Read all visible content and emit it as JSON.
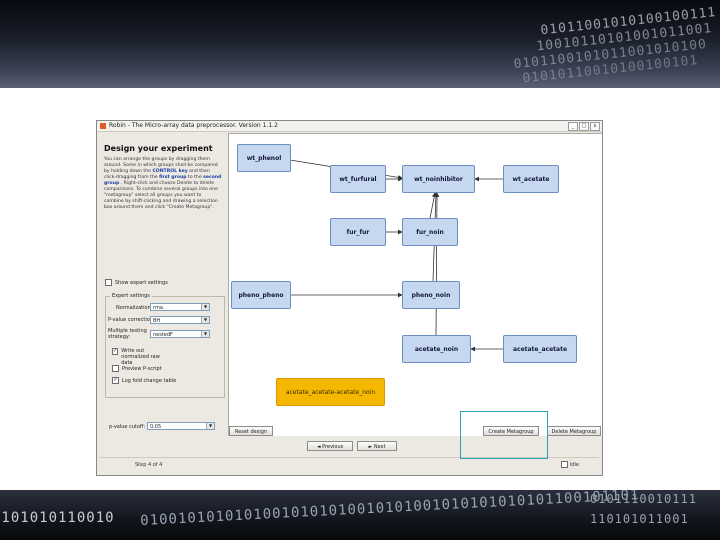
{
  "window": {
    "title": "Robin - The Micro-array data preprocessor. Version 1.1.2",
    "buttons": [
      "_",
      "□",
      "x"
    ]
  },
  "left_panel": {
    "heading": "Design your experiment",
    "description": {
      "t1": "You can arrange the groups by dragging them around. Some in which groups shall be compared by holding down the",
      "control_key": "CONTROL key",
      "t2": "and then click-dragging from the",
      "first_group": "first group",
      "t3": "to the",
      "second_group": "second group",
      "t4": ". Right-click and choose Delete to delete comparisons. To combine several groups into one \"metagroup\" select all groups you want to combine by shift-clicking and drawing a selection box around them and click \"Create Metagroup\"."
    },
    "show_expert": {
      "label": "Show expert settings",
      "checked": false
    },
    "expert_settings": {
      "title": "Expert settings",
      "normalization": {
        "label": "Normalization:",
        "value": "rma"
      },
      "pvalue_correction": {
        "label": "P-value correction:",
        "value": "BH"
      },
      "multiple_testing": {
        "label": "Multiple testing strategy:",
        "value": "nestedF"
      },
      "write_normalized": {
        "label": "Write out normalized raw data",
        "checked": true
      },
      "preview_plot": {
        "label": "Preview P-script",
        "checked": false
      },
      "log_fold_change": {
        "label": "Log fold change table",
        "checked": true
      }
    },
    "pvalue_cutoff": {
      "label": "p-value cutoff:",
      "value": "0.05"
    }
  },
  "diagram": {
    "nodes": [
      {
        "id": "wt_phenol",
        "label": "wt_phenol",
        "type": "group"
      },
      {
        "id": "wt_furfural",
        "label": "wt_furfural",
        "type": "group"
      },
      {
        "id": "wt_noinhibitor",
        "label": "wt_noinhibitor",
        "type": "group"
      },
      {
        "id": "wt_acetate",
        "label": "wt_acetate",
        "type": "group"
      },
      {
        "id": "fur_fur",
        "label": "fur_fur",
        "type": "group"
      },
      {
        "id": "fur_noin",
        "label": "fur_noin",
        "type": "group"
      },
      {
        "id": "pheno_pheno",
        "label": "pheno_pheno",
        "type": "group"
      },
      {
        "id": "pheno_noin",
        "label": "pheno_noin",
        "type": "group"
      },
      {
        "id": "acetate_noin",
        "label": "acetate_noin",
        "type": "group"
      },
      {
        "id": "acetate_acetate",
        "label": "acetate_acetate",
        "type": "group"
      },
      {
        "id": "meta",
        "label": "acetate_acetate-acetate_noin",
        "type": "metagroup"
      }
    ],
    "edges": [
      [
        "wt_phenol",
        "wt_noinhibitor"
      ],
      [
        "wt_furfural",
        "wt_noinhibitor"
      ],
      [
        "wt_acetate",
        "wt_noinhibitor"
      ],
      [
        "fur_fur",
        "fur_noin"
      ],
      [
        "fur_noin",
        "wt_noinhibitor"
      ],
      [
        "pheno_pheno",
        "pheno_noin"
      ],
      [
        "pheno_noin",
        "wt_noinhibitor"
      ],
      [
        "acetate_acetate",
        "acetate_noin"
      ],
      [
        "acetate_noin",
        "wt_noinhibitor"
      ]
    ]
  },
  "canvas_buttons": {
    "reset": "Reset design",
    "create_meta": "Create Metagroup",
    "delete_meta": "Delete Metagroup"
  },
  "nav": {
    "previous": "◄ Previous",
    "next": "► Next"
  },
  "status": {
    "step": "Step 4 of 4",
    "idle": "Idle"
  },
  "banner": {
    "top_binary": [
      "01011001010100100111",
      "10010110101001011001",
      "0101100101011001010100",
      "01010110010100100101"
    ],
    "bottom_binary": [
      "0101010110010",
      "01001010101010010101010010101001010101010101100101101",
      "0101110010111",
      "110101011001"
    ]
  }
}
